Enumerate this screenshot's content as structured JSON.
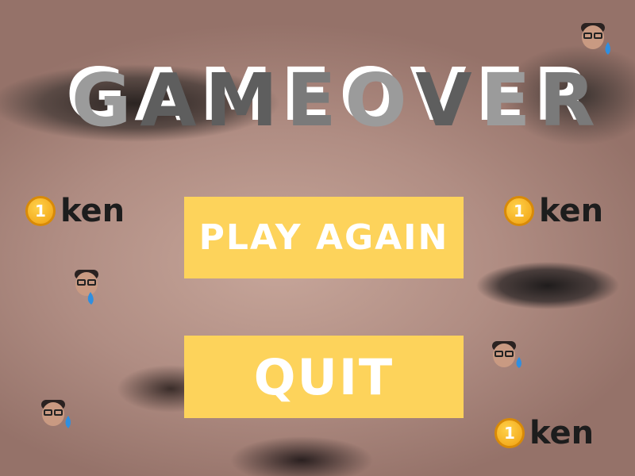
{
  "title": {
    "letters": [
      "G",
      "A",
      "M",
      "E",
      "O",
      "V",
      "E",
      "R"
    ]
  },
  "buttons": {
    "play_again": "PLAY AGAIN",
    "quit": "QUIT"
  },
  "tokens": {
    "coin_value": "1",
    "label": "ken"
  },
  "colors": {
    "button_bg": "#fdd35b",
    "button_text": "#ffffff",
    "title_light": "#9b9b9b",
    "title_dark": "#5e5e5e"
  },
  "icons": {
    "coin": "coin-icon",
    "face": "crying-face-icon"
  }
}
